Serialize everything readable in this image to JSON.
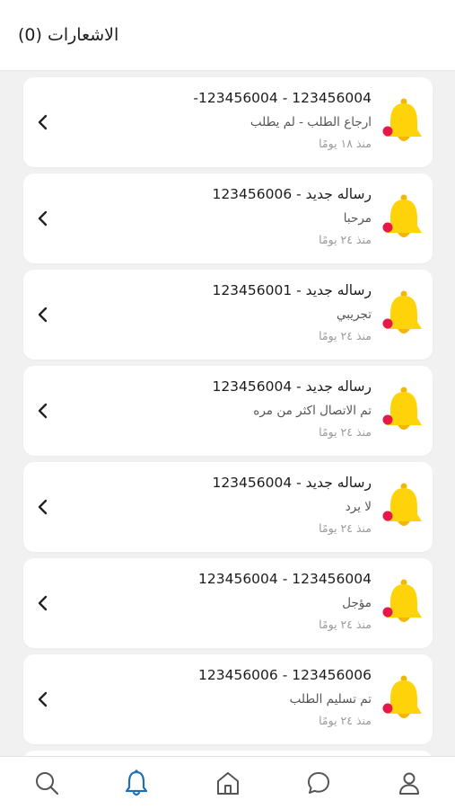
{
  "header": {
    "title": "الاشعارات (0)"
  },
  "colors": {
    "bell": "#ffd30a",
    "bell_shade": "#f2b705",
    "dot": "#e8174a",
    "active_nav": "#1f6fb2",
    "inactive_nav": "#555555"
  },
  "notifications": [
    {
      "title": "123456004 - 123456004-",
      "body": "ارجاع الطلب - لم يطلب",
      "time": "منذ ١٨ يومًا"
    },
    {
      "title": "رساله جديد - 123456006",
      "body": "مرحبا",
      "time": "منذ ٢٤ يومًا"
    },
    {
      "title": "رساله جديد - 123456001",
      "body": "تجريبي",
      "time": "منذ ٢٤ يومًا"
    },
    {
      "title": "رساله جديد - 123456004",
      "body": "تم الاتصال اكثر من مره",
      "time": "منذ ٢٤ يومًا"
    },
    {
      "title": "رساله جديد - 123456004",
      "body": "لا يرد",
      "time": "منذ ٢٤ يومًا"
    },
    {
      "title": "123456004 - 123456004",
      "body": "مؤجل",
      "time": "منذ ٢٤ يومًا"
    },
    {
      "title": "123456006 - 123456006",
      "body": "تم تسليم الطلب",
      "time": "منذ ٢٤ يومًا"
    }
  ],
  "bottom_nav": [
    {
      "icon": "search-icon",
      "active": false
    },
    {
      "icon": "bell-icon",
      "active": true
    },
    {
      "icon": "home-icon",
      "active": false
    },
    {
      "icon": "chat-icon",
      "active": false
    },
    {
      "icon": "user-icon",
      "active": false
    }
  ]
}
